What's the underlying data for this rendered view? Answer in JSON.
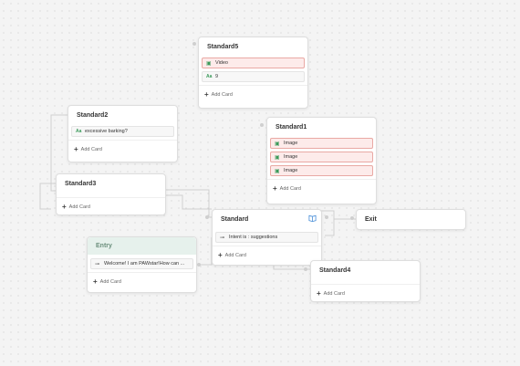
{
  "nodes": {
    "standard5": {
      "title": "Standard5",
      "cards": [
        {
          "icon": "image-icon",
          "label": "Video"
        },
        {
          "icon": "text-icon",
          "label": "9"
        }
      ],
      "add_label": "Add Card"
    },
    "standard2": {
      "title": "Standard2",
      "cards": [
        {
          "icon": "text-icon",
          "label": "excessive barking?"
        }
      ],
      "add_label": "Add Card"
    },
    "standard1": {
      "title": "Standard1",
      "cards": [
        {
          "icon": "image-icon",
          "label": "Image"
        },
        {
          "icon": "image-icon",
          "label": "Image"
        },
        {
          "icon": "image-icon",
          "label": "Image"
        }
      ],
      "add_label": "Add Card"
    },
    "standard3": {
      "title": "Standard3",
      "add_label": "Add Card"
    },
    "standard": {
      "title": "Standard",
      "cards": [
        {
          "icon": "intent-icon",
          "label": "Intent is : suggestions"
        }
      ],
      "add_label": "Add Card"
    },
    "exit": {
      "title": "Exit"
    },
    "entry": {
      "title": "Entry",
      "cards": [
        {
          "icon": "intent-icon",
          "label": "Welcome! I am PAWstar!How can ..."
        }
      ],
      "add_label": "Add Card"
    },
    "standard4": {
      "title": "Standard4",
      "add_label": "Add Card"
    }
  },
  "colors": {
    "media_card_bg": "#fdebea",
    "media_card_border": "#e9a9a4",
    "entry_header": "#e6f1ec",
    "icon_green": "#3a9a5a",
    "book_icon": "#4a8fd8"
  }
}
